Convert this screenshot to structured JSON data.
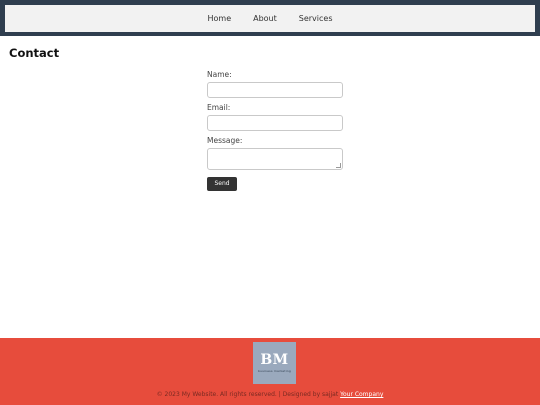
{
  "nav": {
    "items": [
      {
        "label": "Home"
      },
      {
        "label": "About"
      },
      {
        "label": "Services"
      }
    ]
  },
  "page_title": "Contact",
  "form": {
    "name_label": "Name:",
    "email_label": "Email:",
    "message_label": "Message:",
    "send_label": "Send"
  },
  "footer": {
    "logo_mark": "BM",
    "logo_subtitle": "business marketing",
    "copyright_text": "© 2023 My Website. All rights reserved. | Designed by sajjat ",
    "company_link": "Your Company"
  },
  "colors": {
    "header_frame": "#2f3e4f",
    "footer_bg": "#e74c3c",
    "button_bg": "#333333"
  }
}
